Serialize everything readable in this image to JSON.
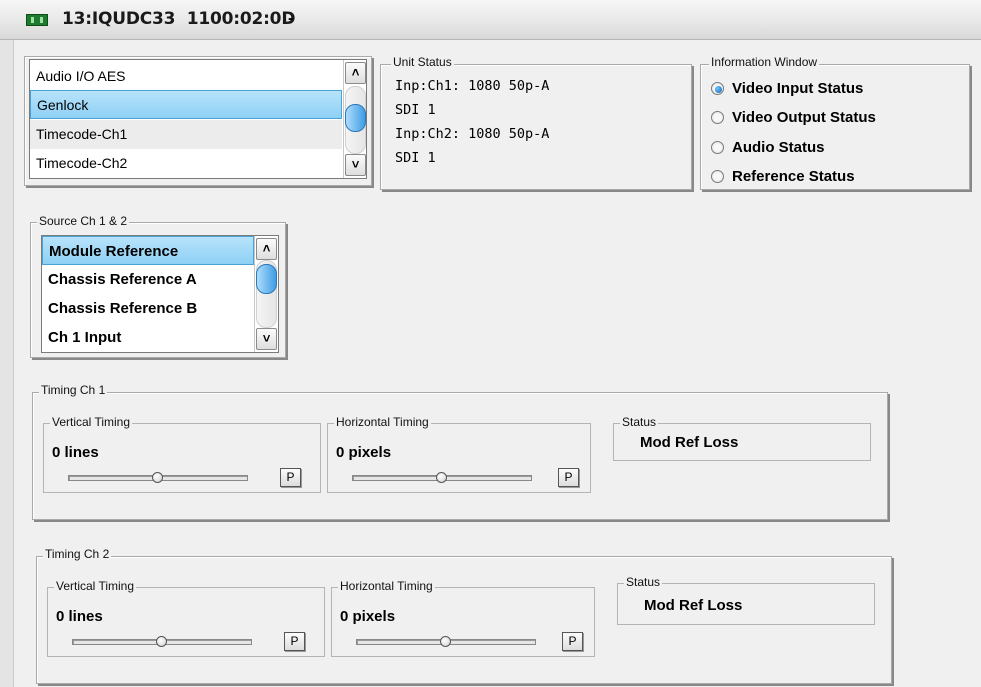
{
  "window": {
    "title": "13:IQUDC33  1100:02:0D",
    "title_suffix": "-"
  },
  "module_list": {
    "items": [
      {
        "label": "Audio I/O AES"
      },
      {
        "label": "Genlock"
      },
      {
        "label": "Timecode-Ch1"
      },
      {
        "label": "Timecode-Ch2"
      }
    ],
    "selected_index": 1
  },
  "unit_status": {
    "legend": "Unit Status",
    "lines": [
      "Inp:Ch1: 1080 50p-A",
      "SDI 1",
      "Inp:Ch2: 1080 50p-A",
      "SDI 1"
    ]
  },
  "info_window": {
    "legend": "Information Window",
    "options": [
      {
        "label": "Video Input Status",
        "checked": true
      },
      {
        "label": "Video Output Status",
        "checked": false
      },
      {
        "label": "Audio Status",
        "checked": false
      },
      {
        "label": "Reference Status",
        "checked": false
      }
    ]
  },
  "source": {
    "legend": "Source Ch 1 & 2",
    "items": [
      {
        "label": "Module Reference"
      },
      {
        "label": "Chassis Reference A"
      },
      {
        "label": "Chassis Reference B"
      },
      {
        "label": "Ch 1 Input"
      }
    ],
    "selected_index": 0
  },
  "timing_ch1": {
    "legend": "Timing Ch 1",
    "vertical": {
      "legend": "Vertical Timing",
      "value": "0 lines",
      "level": 0.5,
      "p_label": "P"
    },
    "horizontal": {
      "legend": "Horizontal Timing",
      "value": "0 pixels",
      "level": 0.5,
      "p_label": "P"
    },
    "status": {
      "legend": "Status",
      "value": "Mod Ref Loss"
    }
  },
  "timing_ch2": {
    "legend": "Timing Ch 2",
    "vertical": {
      "legend": "Vertical Timing",
      "value": "0 lines",
      "level": 0.5,
      "p_label": "P"
    },
    "horizontal": {
      "legend": "Horizontal Timing",
      "value": "0 pixels",
      "level": 0.5,
      "p_label": "P"
    },
    "status": {
      "legend": "Status",
      "value": "Mod Ref Loss"
    }
  }
}
